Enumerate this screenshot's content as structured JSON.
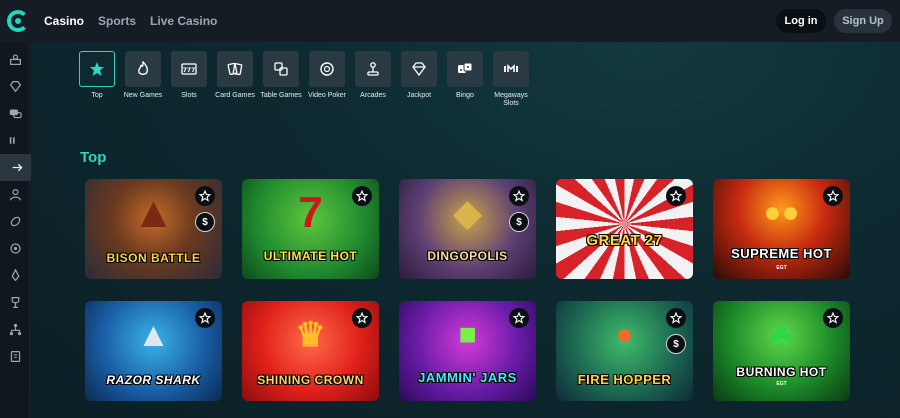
{
  "header": {
    "nav": [
      {
        "label": "Casino",
        "active": true
      },
      {
        "label": "Sports",
        "active": false
      },
      {
        "label": "Live Casino",
        "active": false
      }
    ],
    "login_label": "Log in",
    "signup_label": "Sign Up"
  },
  "sidebar": {
    "icons": [
      "casino-icon",
      "diamond-icon",
      "chat-icon",
      "promo-icon",
      "arrow-right-icon",
      "user-icon",
      "football-icon",
      "badge-icon",
      "rocket-icon",
      "trophy-icon",
      "tree-icon",
      "book-icon"
    ]
  },
  "categories": [
    {
      "label": "Top",
      "icon": "star-icon",
      "active": true
    },
    {
      "label": "New Games",
      "icon": "flame-icon",
      "active": false
    },
    {
      "label": "Slots",
      "icon": "slots-777-icon",
      "active": false
    },
    {
      "label": "Card Games",
      "icon": "cards-icon",
      "active": false
    },
    {
      "label": "Table Games",
      "icon": "table-dice-icon",
      "active": false
    },
    {
      "label": "Video Poker",
      "icon": "poker-chip-icon",
      "active": false
    },
    {
      "label": "Arcades",
      "icon": "joystick-icon",
      "active": false
    },
    {
      "label": "Jackpot",
      "icon": "diamond-icon",
      "active": false
    },
    {
      "label": "Bingo",
      "icon": "dice-icon",
      "active": false
    },
    {
      "label": "Megaways Slots",
      "icon": "megaways-icon",
      "active": false
    }
  ],
  "section": {
    "title": "Top"
  },
  "games": [
    {
      "name": "BISON BATTLE",
      "sub": "",
      "coin": true
    },
    {
      "name": "ULTIMATE HOT",
      "sub": "",
      "coin": false
    },
    {
      "name": "DINGOPOLIS",
      "sub": "",
      "coin": true
    },
    {
      "name": "GREAT 27",
      "sub": "",
      "coin": false
    },
    {
      "name": "SUPREME HOT",
      "sub": "EGT",
      "coin": false
    },
    {
      "name": "RAZOR SHARK",
      "sub": "",
      "coin": false
    },
    {
      "name": "SHINING CROWN",
      "sub": "",
      "coin": false
    },
    {
      "name": "JAMMIN' JARS",
      "sub": "",
      "coin": false
    },
    {
      "name": "FIRE HOPPER",
      "sub": "",
      "coin": true
    },
    {
      "name": "BURNING HOT",
      "sub": "EGT",
      "coin": false
    }
  ],
  "colors": {
    "accent": "#2fd5c4",
    "topbar": "#151c23",
    "sidebar": "#10171d"
  }
}
